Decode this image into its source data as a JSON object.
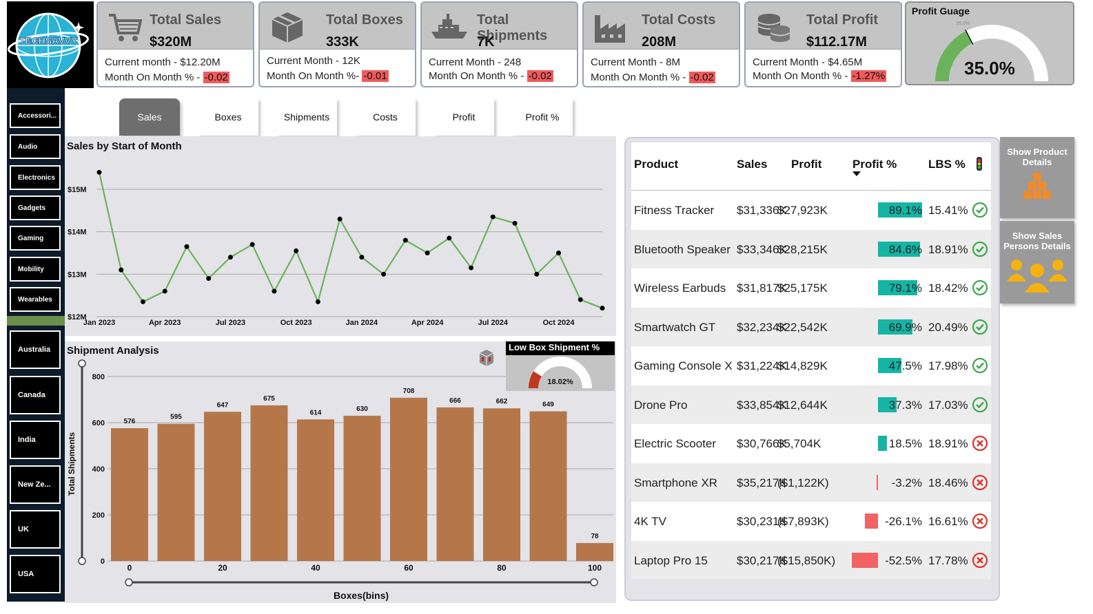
{
  "kpis": [
    {
      "title": "Total Sales",
      "value": "$320M",
      "line1": "Current month - $12.20M",
      "line2_prefix": "Month On Month % - ",
      "line2_value": "-0.02",
      "icon": "cart-icon"
    },
    {
      "title": "Total Boxes",
      "value": "333K",
      "line1": "Current Month - 12K",
      "line2_prefix": "Month On Month %- ",
      "line2_value": "-0.01",
      "icon": "box-icon"
    },
    {
      "title": "Total Shipments",
      "value": "7K",
      "line1": "Current Month - 248",
      "line2_prefix": "Month On Month % - ",
      "line2_value": "-0.02",
      "icon": "ship-icon"
    },
    {
      "title": "Total Costs",
      "value": "208M",
      "line1": "Current Month - 8M",
      "line2_prefix": "Month On Month % - ",
      "line2_value": "-0.02",
      "icon": "factory-icon"
    },
    {
      "title": "Total Profit",
      "value": "$112.17M",
      "line1": "Current Month - $4.65M",
      "line2_prefix": "Month On Month % - ",
      "line2_value": "-1.27%",
      "icon": "coins-icon"
    }
  ],
  "profit_gauge": {
    "title": "Profit Guage",
    "value": "35.0%",
    "target": "35.0%",
    "fraction": 0.35
  },
  "logo": {
    "text": "TECHSAVVY"
  },
  "categories": [
    "Accessori...",
    "Audio",
    "Electronics",
    "Gadgets",
    "Gaming",
    "Mobility",
    "Wearables"
  ],
  "countries": [
    "Australia",
    "Canada",
    "India",
    "New Ze...",
    "UK",
    "USA"
  ],
  "tabs": [
    "Sales",
    "Boxes",
    "Shipments",
    "Costs",
    "Profit",
    "Profit %"
  ],
  "active_tab": "Sales",
  "line_chart": {
    "title": "Sales by Start of Month"
  },
  "bar_chart": {
    "title": "Shipment Analysis",
    "xlabel": "Boxes(bins)",
    "ylabel": "Total Shipments"
  },
  "low_box": {
    "title": "Low Box Shipment %",
    "value": "18.02%",
    "fraction": 0.1802
  },
  "table": {
    "headers": [
      "Product",
      "Sales",
      "Profit",
      "Profit %",
      "LBS %"
    ],
    "rows": [
      {
        "product": "Fitness Tracker",
        "sales": "$31,336K",
        "profit": "$27,923K",
        "profit_pct": "89.1%",
        "pct_value": 89.1,
        "lbs": "15.41%",
        "status": "ok"
      },
      {
        "product": "Bluetooth Speaker",
        "sales": "$33,346K",
        "profit": "$28,215K",
        "profit_pct": "84.6%",
        "pct_value": 84.6,
        "lbs": "18.91%",
        "status": "ok"
      },
      {
        "product": "Wireless Earbuds",
        "sales": "$31,817K",
        "profit": "$25,175K",
        "profit_pct": "79.1%",
        "pct_value": 79.1,
        "lbs": "18.42%",
        "status": "ok"
      },
      {
        "product": "Smartwatch GT",
        "sales": "$32,234K",
        "profit": "$22,542K",
        "profit_pct": "69.9%",
        "pct_value": 69.9,
        "lbs": "20.49%",
        "status": "ok"
      },
      {
        "product": "Gaming Console X",
        "sales": "$31,224K",
        "profit": "$14,829K",
        "profit_pct": "47.5%",
        "pct_value": 47.5,
        "lbs": "17.98%",
        "status": "ok"
      },
      {
        "product": "Drone Pro",
        "sales": "$33,854K",
        "profit": "$12,644K",
        "profit_pct": "37.3%",
        "pct_value": 37.3,
        "lbs": "17.03%",
        "status": "ok"
      },
      {
        "product": "Electric Scooter",
        "sales": "$30,766K",
        "profit": "$5,704K",
        "profit_pct": "18.5%",
        "pct_value": 18.5,
        "lbs": "18.91%",
        "status": "bad"
      },
      {
        "product": "Smartphone XR",
        "sales": "$35,217K",
        "profit": "($1,122K)",
        "profit_pct": "-3.2%",
        "pct_value": -3.2,
        "lbs": "18.46%",
        "status": "bad"
      },
      {
        "product": "4K TV",
        "sales": "$30,231K",
        "profit": "($7,893K)",
        "profit_pct": "-26.1%",
        "pct_value": -26.1,
        "lbs": "16.61%",
        "status": "bad"
      },
      {
        "product": "Laptop Pro 15",
        "sales": "$30,217K",
        "profit": "($15,850K)",
        "profit_pct": "-52.5%",
        "pct_value": -52.5,
        "lbs": "17.78%",
        "status": "bad"
      }
    ]
  },
  "side_buttons": [
    {
      "label": "Show Product Details",
      "icon": "boxes-stack-icon"
    },
    {
      "label": "Show Sales Persons Details",
      "icon": "people-icon"
    }
  ],
  "colors": {
    "line": "#6bb35a",
    "bar": "#b5774a",
    "pos_bar": "#15b5a6",
    "neg_bar": "#f26464",
    "ok": "#3aa84a",
    "bad": "#d9342b"
  },
  "chart_data": [
    {
      "type": "line",
      "title": "Sales by Start of Month",
      "x": [
        "Jan 2023",
        "Feb 2023",
        "Mar 2023",
        "Apr 2023",
        "May 2023",
        "Jun 2023",
        "Jul 2023",
        "Aug 2023",
        "Sep 2023",
        "Oct 2023",
        "Nov 2023",
        "Dec 2023",
        "Jan 2024",
        "Feb 2024",
        "Mar 2024",
        "Apr 2024",
        "May 2024",
        "Jun 2024",
        "Jul 2024",
        "Aug 2024",
        "Sep 2024",
        "Oct 2024",
        "Nov 2024",
        "Dec 2024"
      ],
      "tick_labels": [
        "Jan 2023",
        "Apr 2023",
        "Jul 2023",
        "Oct 2023",
        "Jan 2024",
        "Apr 2024",
        "Jul 2024",
        "Oct 2024"
      ],
      "values": [
        15.4,
        13.1,
        12.35,
        12.6,
        13.65,
        12.9,
        13.4,
        13.7,
        12.6,
        13.55,
        12.35,
        14.3,
        13.4,
        13.0,
        13.8,
        13.5,
        13.85,
        13.15,
        14.35,
        14.2,
        13.0,
        13.5,
        12.4,
        12.2
      ],
      "ylim": [
        12,
        15.6
      ],
      "yticks": [
        "$12M",
        "$13M",
        "$14M",
        "$15M"
      ],
      "xlabel": "",
      "ylabel": "",
      "grid": true
    },
    {
      "type": "bar",
      "title": "Shipment Analysis",
      "categories": [
        "0-10",
        "10-20",
        "20-30",
        "30-40",
        "40-50",
        "50-60",
        "60-70",
        "70-80",
        "80-90",
        "90-100",
        "100+"
      ],
      "values": [
        576,
        595,
        647,
        675,
        614,
        630,
        708,
        666,
        662,
        649,
        78
      ],
      "xticks": [
        "0",
        "20",
        "40",
        "60",
        "80",
        "100"
      ],
      "yticks": [
        "0",
        "200",
        "400",
        "600",
        "800"
      ],
      "ylim": [
        0,
        800
      ],
      "xlabel": "Boxes(bins)",
      "ylabel": "Total Shipments",
      "grid": true
    }
  ]
}
